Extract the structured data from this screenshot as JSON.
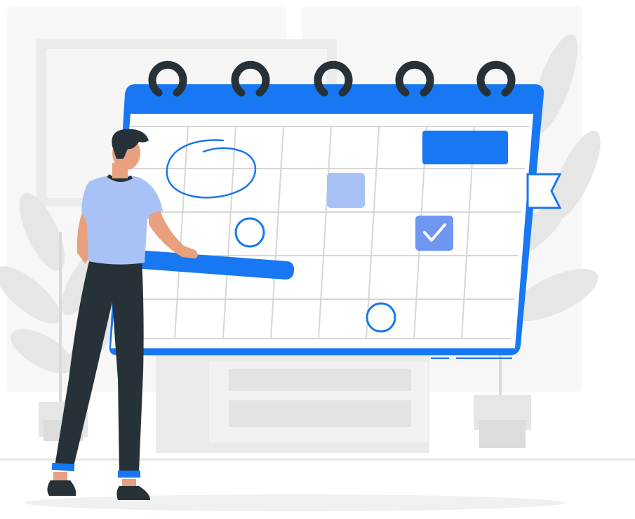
{
  "illustration": {
    "subject": "person-planning-on-calendar",
    "colors": {
      "accent": "#1877F2",
      "accent_light": "#9DB9F4",
      "accent_soft": "#6F96F0",
      "paper": "#FFFFFF",
      "grid": "#D9D9D9",
      "ring": "#263238",
      "background_gray": "#EBEBEB",
      "background_light": "#F5F5F5",
      "shirt": "#A9C2F6",
      "pants": "#263238",
      "skin": "#E9A07E",
      "hair": "#263238"
    },
    "icons": {
      "calendar": "calendar-icon",
      "checkmark": "checkmark-icon",
      "bookmark": "bookmark-flag-icon"
    }
  }
}
